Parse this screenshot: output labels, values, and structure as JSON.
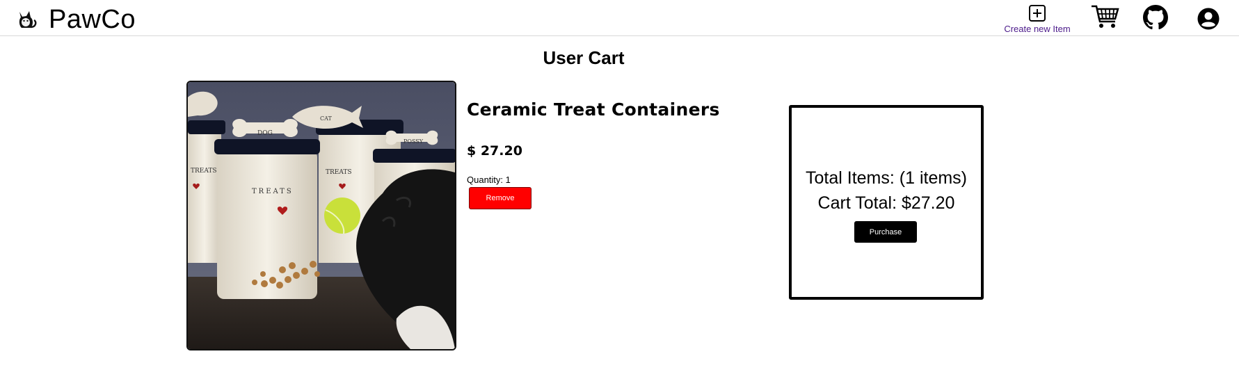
{
  "header": {
    "brand": "PawCo",
    "logo_icon": "cat-icon",
    "create_label": "Create new Item",
    "create_icon": "plus-square-icon",
    "cart_icon": "shopping-cart-icon",
    "github_icon": "github-icon",
    "account_icon": "user-circle-icon",
    "link_color": "#4b1a8a"
  },
  "page": {
    "title": "User Cart"
  },
  "cart_item": {
    "image_alt": "ceramic treat jars with dog, bone and fish lids, tennis ball and treats",
    "image_text": {
      "lid_left": "DOG",
      "lid_middle": "CAT",
      "lid_right": "POSSY",
      "jar_label": "TREATS"
    },
    "name": "Ceramic Treat Containers",
    "price": "$ 27.20",
    "quantity": "Quantity: 1",
    "remove_label": "Remove"
  },
  "summary": {
    "total_items": "Total Items: (1 items)",
    "cart_total": "Cart Total: $27.20",
    "purchase_label": "Purchase"
  },
  "colors": {
    "remove_button": "#ff0000",
    "purchase_button": "#000000"
  }
}
